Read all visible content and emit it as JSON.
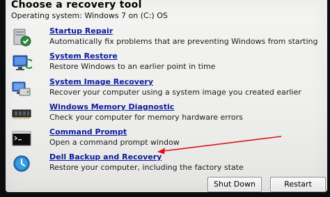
{
  "window": {
    "title": "Choose a recovery tool",
    "os_line": "Operating system: Windows 7 on (C:) OS"
  },
  "tools": [
    {
      "label": "Startup Repair",
      "description": "Automatically fix problems that are preventing Windows from starting",
      "icon": "startup-repair-icon"
    },
    {
      "label": "System Restore",
      "description": "Restore Windows to an earlier point in time",
      "icon": "system-restore-icon"
    },
    {
      "label": "System Image Recovery",
      "description": "Recover your computer using a system image you created earlier",
      "icon": "system-image-recovery-icon"
    },
    {
      "label": "Windows Memory Diagnostic",
      "description": "Check your computer for memory hardware errors",
      "icon": "memory-chip-icon"
    },
    {
      "label": "Command Prompt",
      "description": "Open a command prompt window",
      "icon": "command-prompt-icon"
    },
    {
      "label": "Dell Backup and Recovery",
      "description": "Restore your computer, including the factory state",
      "icon": "dell-backup-clock-icon"
    }
  ],
  "buttons": {
    "shutdown": "Shut Down",
    "restart": "Restart"
  },
  "annotation": {
    "arrow_color": "#e0121a"
  },
  "colors": {
    "link": "#0a1a9c",
    "panel": "#f0f0ee"
  }
}
